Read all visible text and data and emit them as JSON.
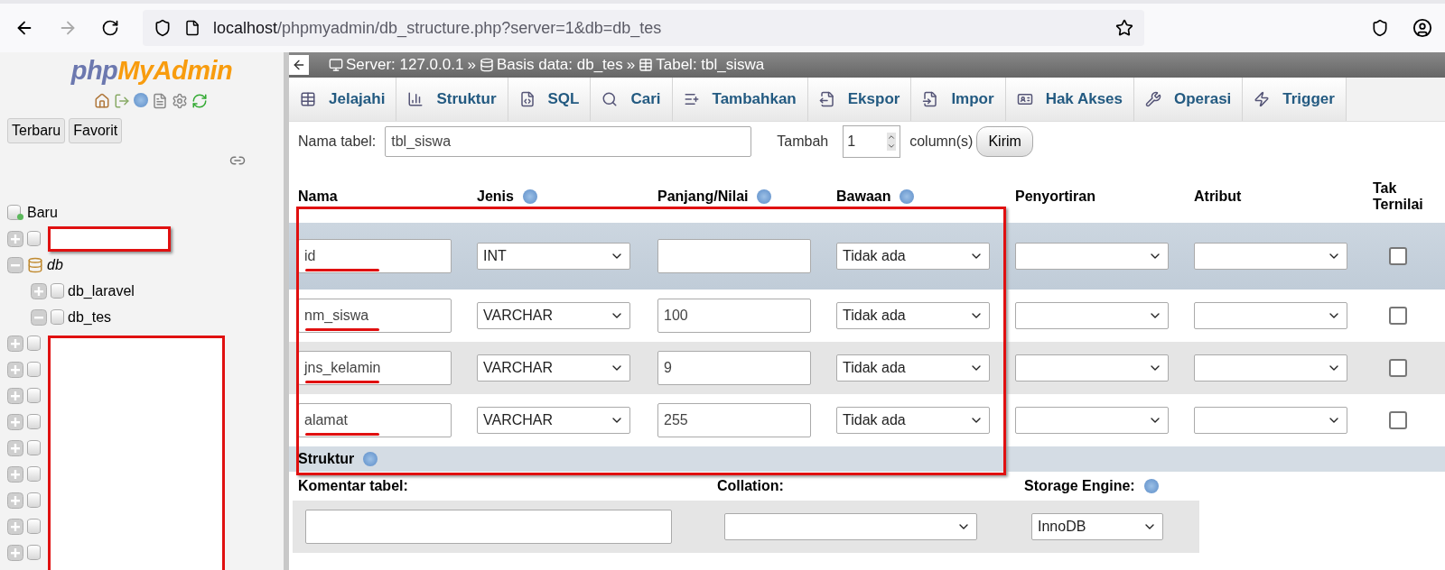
{
  "browser": {
    "url_host": "localhost",
    "url_path": "/phpmyadmin/db_structure.php?server=1&db=db_tes",
    "forward_disabled": true
  },
  "sidebar": {
    "logo": {
      "first": "php",
      "second": "MyAdmin"
    },
    "buttons": [
      "Terbaru",
      "Favorit"
    ],
    "tree": [
      {
        "kind": "new",
        "label": "Baru"
      },
      {
        "kind": "redacted",
        "expanded": false
      },
      {
        "kind": "group",
        "label": "db",
        "expanded": true,
        "children": [
          {
            "kind": "db",
            "label": "db_laravel",
            "expanded": false
          },
          {
            "kind": "db",
            "label": "db_tes",
            "expanded": true
          }
        ]
      }
    ],
    "hidden_nodes": [
      {
        "expanded": false
      },
      {
        "expanded": false
      },
      {
        "expanded": false
      },
      {
        "expanded": false
      },
      {
        "expanded": false
      },
      {
        "expanded": false
      },
      {
        "expanded": false
      },
      {
        "expanded": false
      },
      {
        "expanded": false
      }
    ]
  },
  "breadcrumb": {
    "separator": "»",
    "items": [
      {
        "kind": "server",
        "label": "Server: 127.0.0.1"
      },
      {
        "kind": "database",
        "label": "Basis data: db_tes"
      },
      {
        "kind": "table",
        "label": "Tabel: tbl_siswa"
      }
    ]
  },
  "tabs": [
    {
      "kind": "browse",
      "label": "Jelajahi"
    },
    {
      "kind": "structure",
      "label": "Struktur"
    },
    {
      "kind": "sql",
      "label": "SQL"
    },
    {
      "kind": "search",
      "label": "Cari"
    },
    {
      "kind": "insert",
      "label": "Tambahkan"
    },
    {
      "kind": "export",
      "label": "Ekspor"
    },
    {
      "kind": "import",
      "label": "Impor"
    },
    {
      "kind": "privileges",
      "label": "Hak Akses"
    },
    {
      "kind": "operations",
      "label": "Operasi"
    },
    {
      "kind": "trigger",
      "label": "Trigger"
    }
  ],
  "form": {
    "name_label": "Nama tabel:",
    "name_value": "tbl_siswa",
    "add_label": "Tambah",
    "add_value": "1",
    "add_suffix": "column(s)",
    "submit": "Kirim"
  },
  "columns": [
    {
      "label": "Nama",
      "help": false
    },
    {
      "label": "Jenis",
      "help": true
    },
    {
      "label": "Panjang/Nilai",
      "help": true
    },
    {
      "label": "Bawaan",
      "help": true
    },
    {
      "label": "Penyortiran",
      "help": false
    },
    {
      "label": "Atribut",
      "help": false
    },
    {
      "label": "Tak Ternilai",
      "help": false
    }
  ],
  "rows": [
    {
      "name": "id",
      "type": "INT",
      "length": "",
      "default": "Tidak ada",
      "null": false,
      "highlighted": true,
      "underlined": true
    },
    {
      "name": "nm_siswa",
      "type": "VARCHAR",
      "length": "100",
      "default": "Tidak ada",
      "null": false,
      "highlighted": false,
      "underlined": true
    },
    {
      "name": "jns_kelamin",
      "type": "VARCHAR",
      "length": "9",
      "default": "Tidak ada",
      "null": false,
      "highlighted": false,
      "underlined": true
    },
    {
      "name": "alamat",
      "type": "VARCHAR",
      "length": "255",
      "default": "Tidak ada",
      "null": false,
      "highlighted": false,
      "underlined": true
    }
  ],
  "structure": {
    "title": "Struktur",
    "help": true,
    "comment_label": "Komentar tabel:",
    "collation_label": "Collation:",
    "engine_label": "Storage Engine:",
    "engine_help": true,
    "engine_value": "InnoDB"
  }
}
